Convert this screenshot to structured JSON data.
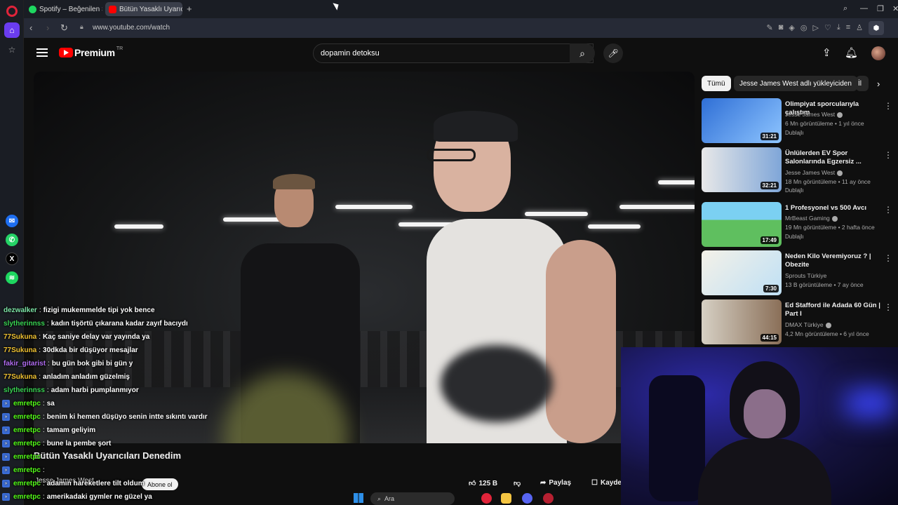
{
  "browser": {
    "tabs": [
      {
        "label": "Spotify – Beğenilen Şarkıl",
        "favicon_color": "#1ed760"
      },
      {
        "label": "Bütün Yasaklı Uyarıcıla",
        "favicon_color": "#ff0000"
      }
    ],
    "new_tab_icon": "plus-icon",
    "url": "www.youtube.com/watch"
  },
  "youtube": {
    "logo_text": "Premium",
    "logo_sup": "TR",
    "search_value": "dopamin detoksu",
    "video": {
      "title": "Bütün Yasaklı Uyarıcıları Denedim",
      "channel": "Jesse James West",
      "subscribe_label": "Abone ol",
      "likes": "125 B",
      "share_label": "Paylaş",
      "save_label": "Kaydet"
    },
    "chips": [
      "Tümü",
      "Jesse James West adlı yükleyiciden",
      "İl"
    ],
    "recommendations": [
      {
        "title": "Olimpiyat sporcularıyla çalıştım",
        "channel": "Jesse James West",
        "meta": "6 Mn görüntüleme • 1 yıl önce",
        "badge": "Dublajlı",
        "duration": "31:21",
        "thumb_color": "#2f6fd6"
      },
      {
        "title": "Ünlülerden EV Spor Salonlarında Egzersiz ...",
        "channel": "Jesse James West",
        "meta": "18 Mn görüntüleme • 11 ay önce",
        "badge": "Dublajlı",
        "duration": "32:21",
        "thumb_color": "#d8d8d8"
      },
      {
        "title": "1 Profesyonel vs 500 Avcı",
        "channel": "MrBeast Gaming",
        "meta": "19 Mn görüntüleme • 2 hafta önce",
        "badge": "Dublajlı",
        "duration": "17:49",
        "thumb_color": "#5fbf5f"
      },
      {
        "title": "Neden Kilo Veremiyoruz ? | Obezite",
        "channel": "Sprouts Türkiye",
        "meta": "13 B görüntüleme • 7 ay önce",
        "badge": "",
        "duration": "7:30",
        "thumb_color": "#f0ede4"
      },
      {
        "title": "Ed Stafford ile Adada 60 Gün | Part I",
        "channel": "DMAX Türkiye",
        "meta": "4,2 Mn görüntüleme • 6 yıl önce",
        "badge": "",
        "duration": "44:15",
        "thumb_color": "#c9c3b8"
      }
    ]
  },
  "chat": [
    {
      "user": "dezwalker",
      "color": "#7ee6a8",
      "text": "fizigi mukemmelde tipi yok bence",
      "kick": false
    },
    {
      "user": "slytherinnss",
      "color": "#39d353",
      "text": "kadın tişörtü çıkarana kadar zayıf bacıydı",
      "kick": false
    },
    {
      "user": "77Sukuna",
      "color": "#f0c232",
      "text": "Kaç saniye delay var yayında ya",
      "kick": false
    },
    {
      "user": "77Sukuna",
      "color": "#f0c232",
      "text": "30dkda bir düşüyor mesajlar",
      "kick": false
    },
    {
      "user": "fakir_gitarist",
      "color": "#b06cf0",
      "text": "bu gün bok gibi bi gün y",
      "kick": false
    },
    {
      "user": "77Sukuna",
      "color": "#f0c232",
      "text": "anladım anladım güzelmiş",
      "kick": false
    },
    {
      "user": "slytherinnss",
      "color": "#39d353",
      "text": "adam harbi pumplanmıyor",
      "kick": false
    },
    {
      "user": "emretpc",
      "color": "#53fc18",
      "text": "sa",
      "kick": true
    },
    {
      "user": "emretpc",
      "color": "#53fc18",
      "text": "benim ki hemen düşüyo senin intte sıkıntı vardır",
      "kick": true
    },
    {
      "user": "emretpc",
      "color": "#53fc18",
      "text": "tamam geliyim",
      "kick": true
    },
    {
      "user": "emretpc",
      "color": "#53fc18",
      "text": "bune la pembe şort",
      "kick": true
    },
    {
      "user": "emretpc",
      "color": "#53fc18",
      "text": "",
      "kick": true
    },
    {
      "user": "emretpc",
      "color": "#53fc18",
      "text": "",
      "kick": true
    },
    {
      "user": "emretpc",
      "color": "#53fc18",
      "text": "adamın hareketlere tilt oldum",
      "kick": true
    },
    {
      "user": "emretpc",
      "color": "#53fc18",
      "text": "amerikadaki gymler ne güzel ya",
      "kick": true
    }
  ],
  "taskbar": {
    "search_placeholder": "Ara"
  }
}
